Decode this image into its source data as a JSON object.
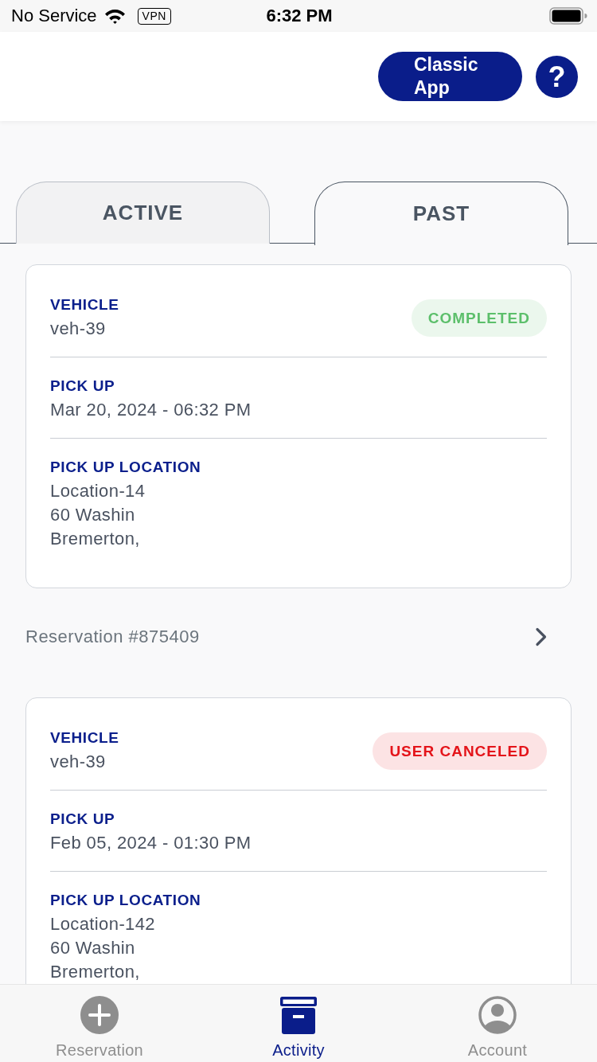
{
  "status_bar": {
    "carrier": "No Service",
    "vpn": "VPN",
    "time": "6:32 PM"
  },
  "header": {
    "classic_button": "Classic App",
    "help_button": "?"
  },
  "tabs": [
    {
      "label": "ACTIVE",
      "selected": false
    },
    {
      "label": "PAST",
      "selected": true
    }
  ],
  "reservations": [
    {
      "status": {
        "label": "COMPLETED",
        "color": "#5cbf6b"
      },
      "fields": [
        {
          "label": "VEHICLE",
          "lines": [
            "veh-39"
          ]
        },
        {
          "label": "PICK UP",
          "lines": [
            "Mar 20, 2024 - 06:32 PM"
          ]
        },
        {
          "label": "PICK UP LOCATION",
          "lines": [
            "Location-14",
            "60 Washin",
            "Bremerton,"
          ]
        }
      ],
      "reservation_number": "Reservation #875409"
    },
    {
      "status": {
        "label": "USER CANCELED",
        "color": "#e4141a"
      },
      "fields": [
        {
          "label": "VEHICLE",
          "lines": [
            "veh-39"
          ]
        },
        {
          "label": "PICK UP",
          "lines": [
            "Feb 05, 2024 - 01:30 PM"
          ]
        },
        {
          "label": "PICK UP LOCATION",
          "lines": [
            "Location-142",
            "60 Washin",
            "Bremerton,"
          ]
        }
      ]
    }
  ],
  "tab_bar": [
    {
      "label": "Reservation",
      "selected": false
    },
    {
      "label": "Activity",
      "selected": true
    },
    {
      "label": "Account",
      "selected": false
    }
  ]
}
